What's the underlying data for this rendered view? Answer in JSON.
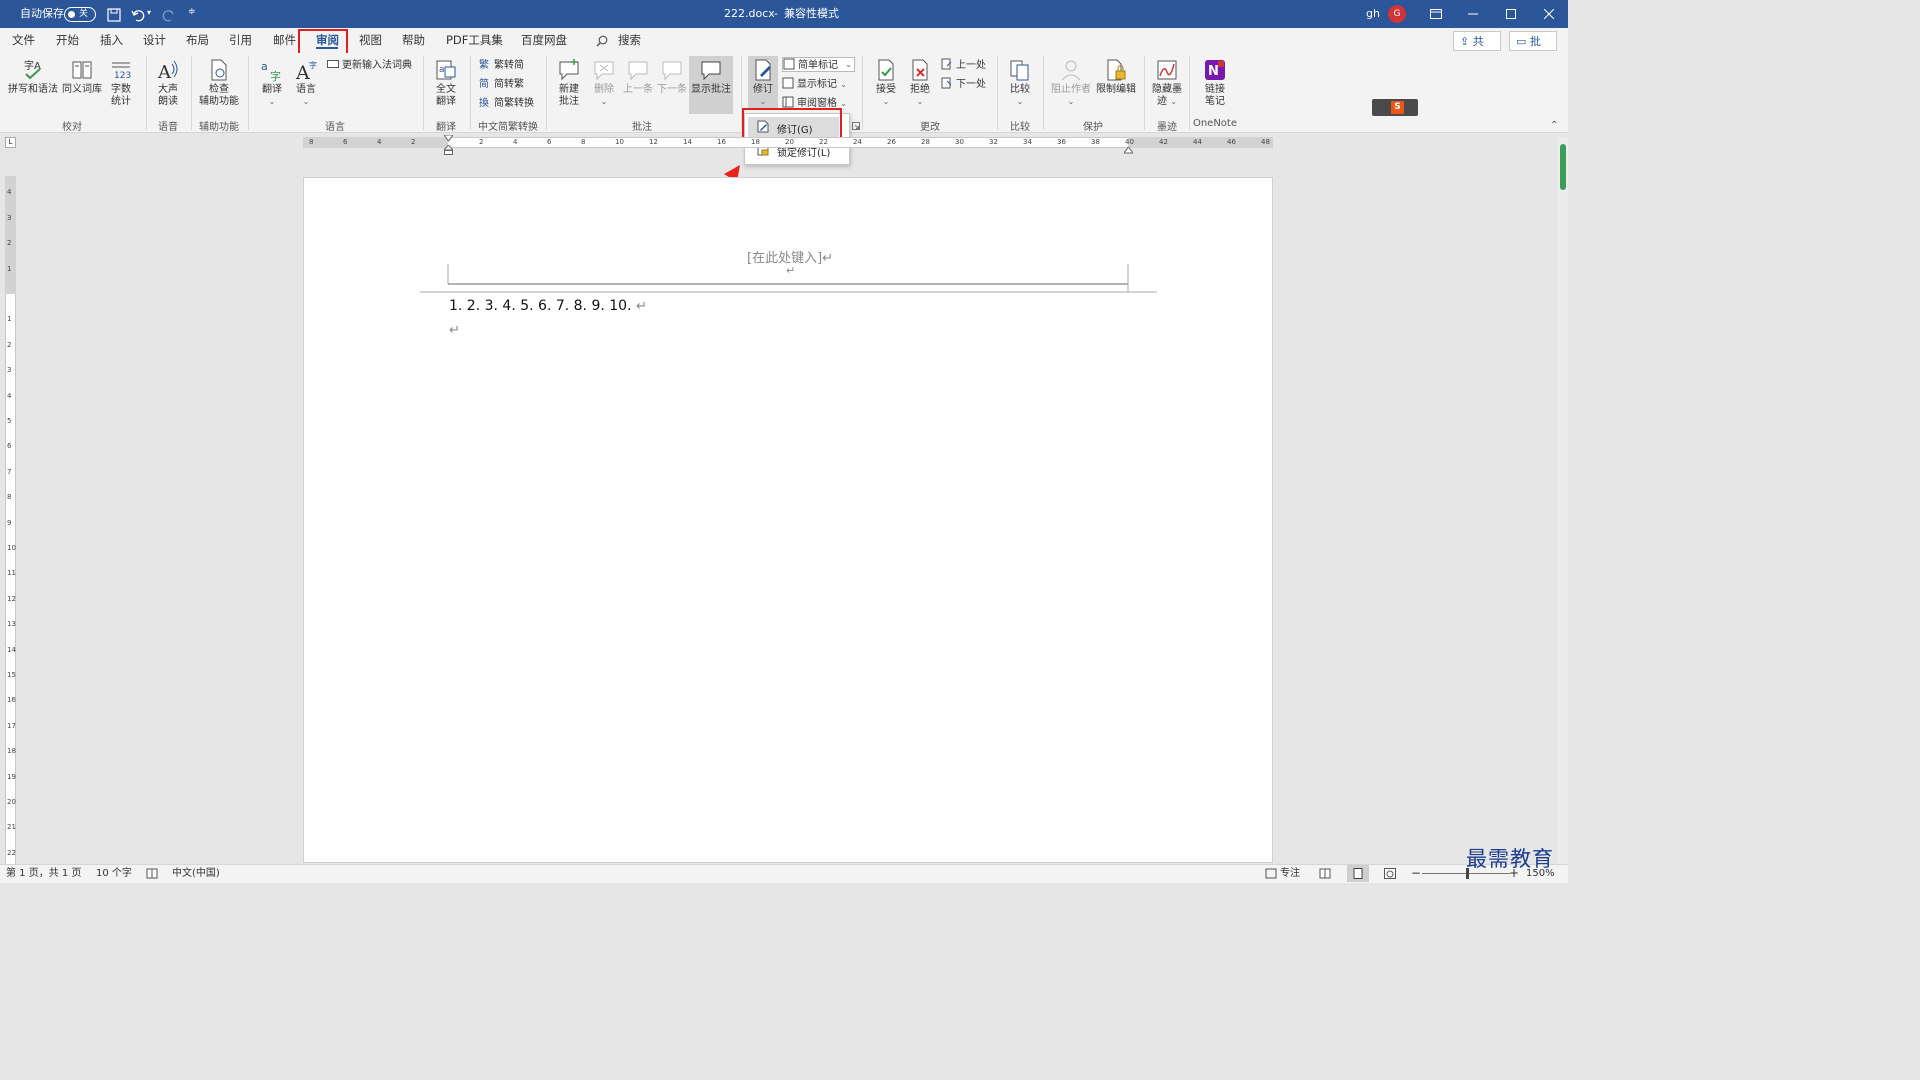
{
  "titlebar": {
    "autosave_label": "自动保存",
    "autosave_state": "关",
    "document_title": "222.docx",
    "separator": "-",
    "mode": "兼容性模式",
    "user": "gh",
    "avatar_initial": "G",
    "accent_color": "#2b579a"
  },
  "menu": {
    "tabs": [
      "文件",
      "开始",
      "插入",
      "设计",
      "布局",
      "引用",
      "邮件",
      "审阅",
      "视图",
      "帮助",
      "PDF工具集",
      "百度网盘"
    ],
    "search_label": "搜索",
    "share_label": "共享",
    "comments_label": "批注"
  },
  "ribbon": {
    "proofing": {
      "spelling": "拼写和语法",
      "thesaurus": "同义词库",
      "wordcount_1": "字数",
      "wordcount_2": "统计",
      "group": "校对"
    },
    "speech": {
      "read_1": "大声",
      "read_2": "朗读",
      "group": "语音"
    },
    "accessibility": {
      "check_1": "检查",
      "check_2": "辅助功能",
      "group": "辅助功能"
    },
    "language": {
      "translate": "翻译",
      "language": "语言",
      "update_ime": "更新输入法词典",
      "group": "语言"
    },
    "fulltranslate": {
      "label_1": "全文",
      "label_2": "翻译",
      "group": "翻译"
    },
    "chinese": {
      "to_simplified": "繁转简",
      "to_traditional": "简转繁",
      "convert": "简繁转换",
      "group": "中文简繁转换"
    },
    "comments": {
      "new_1": "新建",
      "new_2": "批注",
      "delete": "删除",
      "prev": "上一条",
      "next": "下一条",
      "show": "显示批注",
      "group": "批注"
    },
    "tracking": {
      "track": "修订",
      "simple_markup": "简单标记",
      "show_markup": "显示标记",
      "review_pane": "审阅窗格"
    },
    "changes": {
      "accept": "接受",
      "reject": "拒绝",
      "previous": "上一处",
      "next": "下一处",
      "group": "更改"
    },
    "compare": {
      "label": "比较",
      "group": "比较"
    },
    "protect": {
      "block_authors": "阻止作者",
      "restrict": "限制编辑",
      "group": "保护"
    },
    "ink": {
      "hide_1": "隐藏墨",
      "hide_2": "迹",
      "group": "墨迹"
    },
    "onenote": {
      "link_1": "链接",
      "link_2": "笔记",
      "group": "OneNote"
    }
  },
  "dropdown": {
    "item_track": "修订(G)",
    "item_lock": "锁定修订(L)"
  },
  "document": {
    "header_placeholder": "[在此处键入]",
    "line1": "1. 2. 3. 4. 5. 6. 7. 8. 9. 10.",
    "para_mark": "↵"
  },
  "statusbar": {
    "page": "第 1 页，共 1 页",
    "words": "10 个字",
    "language": "中文(中国)",
    "focus": "专注",
    "zoom": "150%"
  },
  "watermark": "最需教育"
}
